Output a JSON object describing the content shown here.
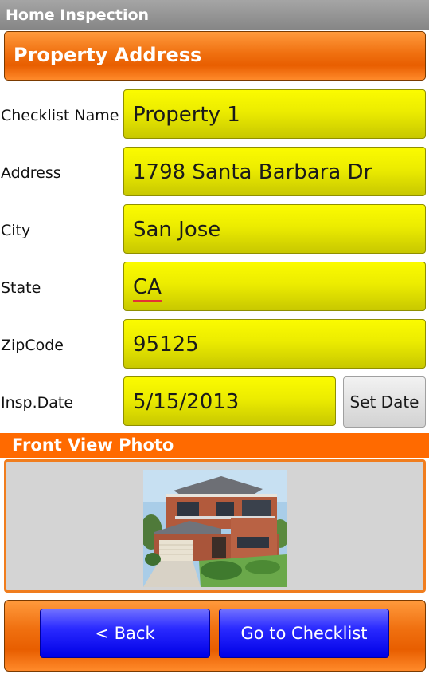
{
  "app": {
    "title": "Home Inspection"
  },
  "header": {
    "section_label": "Property Address"
  },
  "form": {
    "checklist_name": {
      "label": "Checklist Name",
      "value": "Property 1"
    },
    "address": {
      "label": "Address",
      "value": "1798 Santa Barbara Dr"
    },
    "city": {
      "label": "City",
      "value": "San Jose"
    },
    "state": {
      "label": "State",
      "value": "CA"
    },
    "zipcode": {
      "label": "ZipCode",
      "value": "95125"
    },
    "insp_date": {
      "label": "Insp.Date",
      "value": "5/15/2013",
      "button": "Set Date"
    }
  },
  "photo": {
    "header": "Front View Photo",
    "icon": "house-photo"
  },
  "nav": {
    "back": "< Back",
    "go": "Go to Checklist"
  },
  "colors": {
    "accent": "#f07010",
    "field": "#eeee00",
    "nav_button": "#1a1aff"
  }
}
